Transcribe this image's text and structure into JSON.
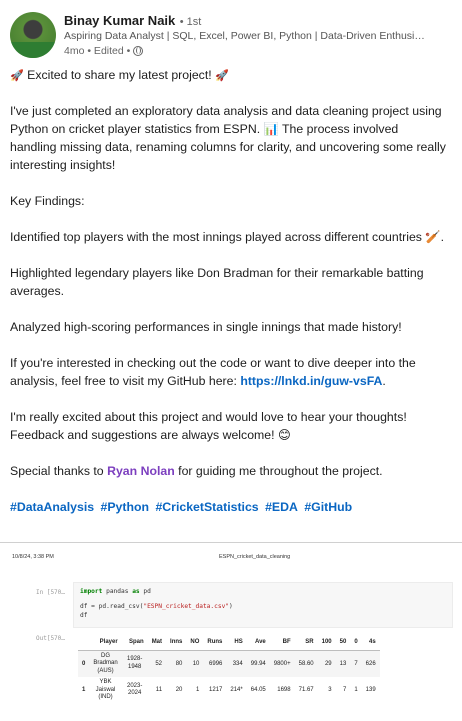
{
  "author": {
    "name": "Binay Kumar Naik",
    "degree": "• 1st",
    "headline": "Aspiring Data Analyst | SQL, Excel, Power BI, Python | Data-Driven Enthusi…",
    "meta": "4mo • Edited •",
    "avatar_badge": "#OPENTOWORK"
  },
  "post": {
    "intro": "Excited to share my latest project!",
    "intro_emoji": "🚀",
    "paragraph1": "I've just completed an exploratory data analysis and data cleaning project using Python on cricket player statistics from ESPN. 📊 The process involved handling missing data, renaming columns for clarity, and uncovering some really interesting insights!",
    "key_findings_label": "Key Findings:",
    "finding1": "Identified top players with the most innings played across different countries 🏏.",
    "finding2": "Highlighted legendary players like Don Bradman for their remarkable batting averages.",
    "finding3": "Analyzed high-scoring performances in single innings that made history!",
    "github_text": "If you're interested in checking out the code or want to dive deeper into the analysis, feel free to visit my GitHub here:",
    "github_link": "https://lnkd.in/guw-vsFA",
    "github_end": ".",
    "thoughts": "I'm really excited about this project and would love to hear your thoughts! Feedback and suggestions are always welcome! 😊",
    "thanks_prefix": "Special thanks to",
    "thanks_mention": "Ryan Nolan",
    "thanks_suffix": "for guiding me throughout the project.",
    "hashtags": [
      "#DataAnalysis",
      "#Python",
      "#CricketStatistics",
      "#EDA",
      "#GitHub"
    ]
  },
  "notebook": {
    "date": "10/8/24, 3:38 PM",
    "title": "ESPN_cricket_data_cleaning",
    "in_prompt": "In [570…",
    "out_prompt": "Out[570…",
    "code_line1_kw1": "import",
    "code_line1_mod": "pandas",
    "code_line1_kw2": "as",
    "code_line1_alias": "pd",
    "code_line2_pre": "df = pd.read_csv(",
    "code_line2_str": "\"ESPN_cricket_data.csv\"",
    "code_line2_post": ")",
    "code_line3": "df",
    "columns": [
      "",
      "Player",
      "Span",
      "Mat",
      "Inns",
      "NO",
      "Runs",
      "HS",
      "Ave",
      "BF",
      "SR",
      "100",
      "50",
      "0",
      "4s"
    ],
    "rows": [
      [
        "0",
        "DG Bradman (AUS)",
        "1928-1948",
        "52",
        "80",
        "10",
        "6996",
        "334",
        "99.94",
        "9800+",
        "58.60",
        "29",
        "13",
        "7",
        "626"
      ],
      [
        "1",
        "YBK Jaiswal (IND)",
        "2023-2024",
        "11",
        "20",
        "1",
        "1217",
        "214*",
        "64.05",
        "1698",
        "71.67",
        "3",
        "7",
        "1",
        "139"
      ]
    ]
  }
}
